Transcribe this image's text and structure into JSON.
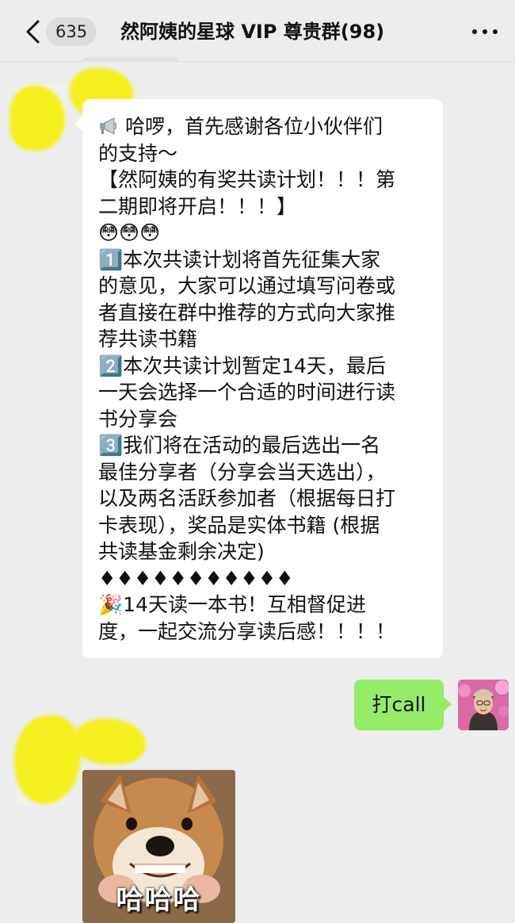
{
  "header": {
    "unread_count": "635",
    "title": "然阿姨的星球 VIP 尊贵群(98)",
    "more_label": "•••"
  },
  "messages": {
    "group_announcement": {
      "lines": [
        "哈啰，首先感谢各位小伙伴们",
        "的支持～",
        "【然阿姨的有奖共读计划！！！第",
        "二期即将开启！！！】",
        "😳😳😳",
        "1️⃣本次共读计划将首先征集大家",
        "的意见，大家可以通过填写问卷或",
        "者直接在群中推荐的方式向大家推",
        "荐共读书籍",
        "2️⃣本次共读计划暂定14天，最后",
        "一天会选择一个合适的时间进行读",
        "书分享会",
        "3️⃣我们将在活动的最后选出一名",
        "最佳分享者（分享会当天选出），",
        "以及两名活跃参加者（根据每日打",
        "卡表现），奖品是实体书籍 (根据",
        "共读基金剩余决定)",
        "♦♦♦♦♦♦♦♦♦♦♦",
        "🎉14天读一本书！互相督促进",
        "度，一起交流分享读后感！！！！"
      ]
    },
    "user_reply": "打call",
    "sticker_caption": "哈哈哈"
  },
  "icons": {
    "megaphone": "megaphone-icon",
    "back": "chevron-left-icon",
    "more": "more-dots-icon"
  },
  "colors": {
    "background": "#ededed",
    "bubble_incoming": "#ffffff",
    "bubble_outgoing": "#95ec69",
    "redaction": "#f5f020"
  }
}
